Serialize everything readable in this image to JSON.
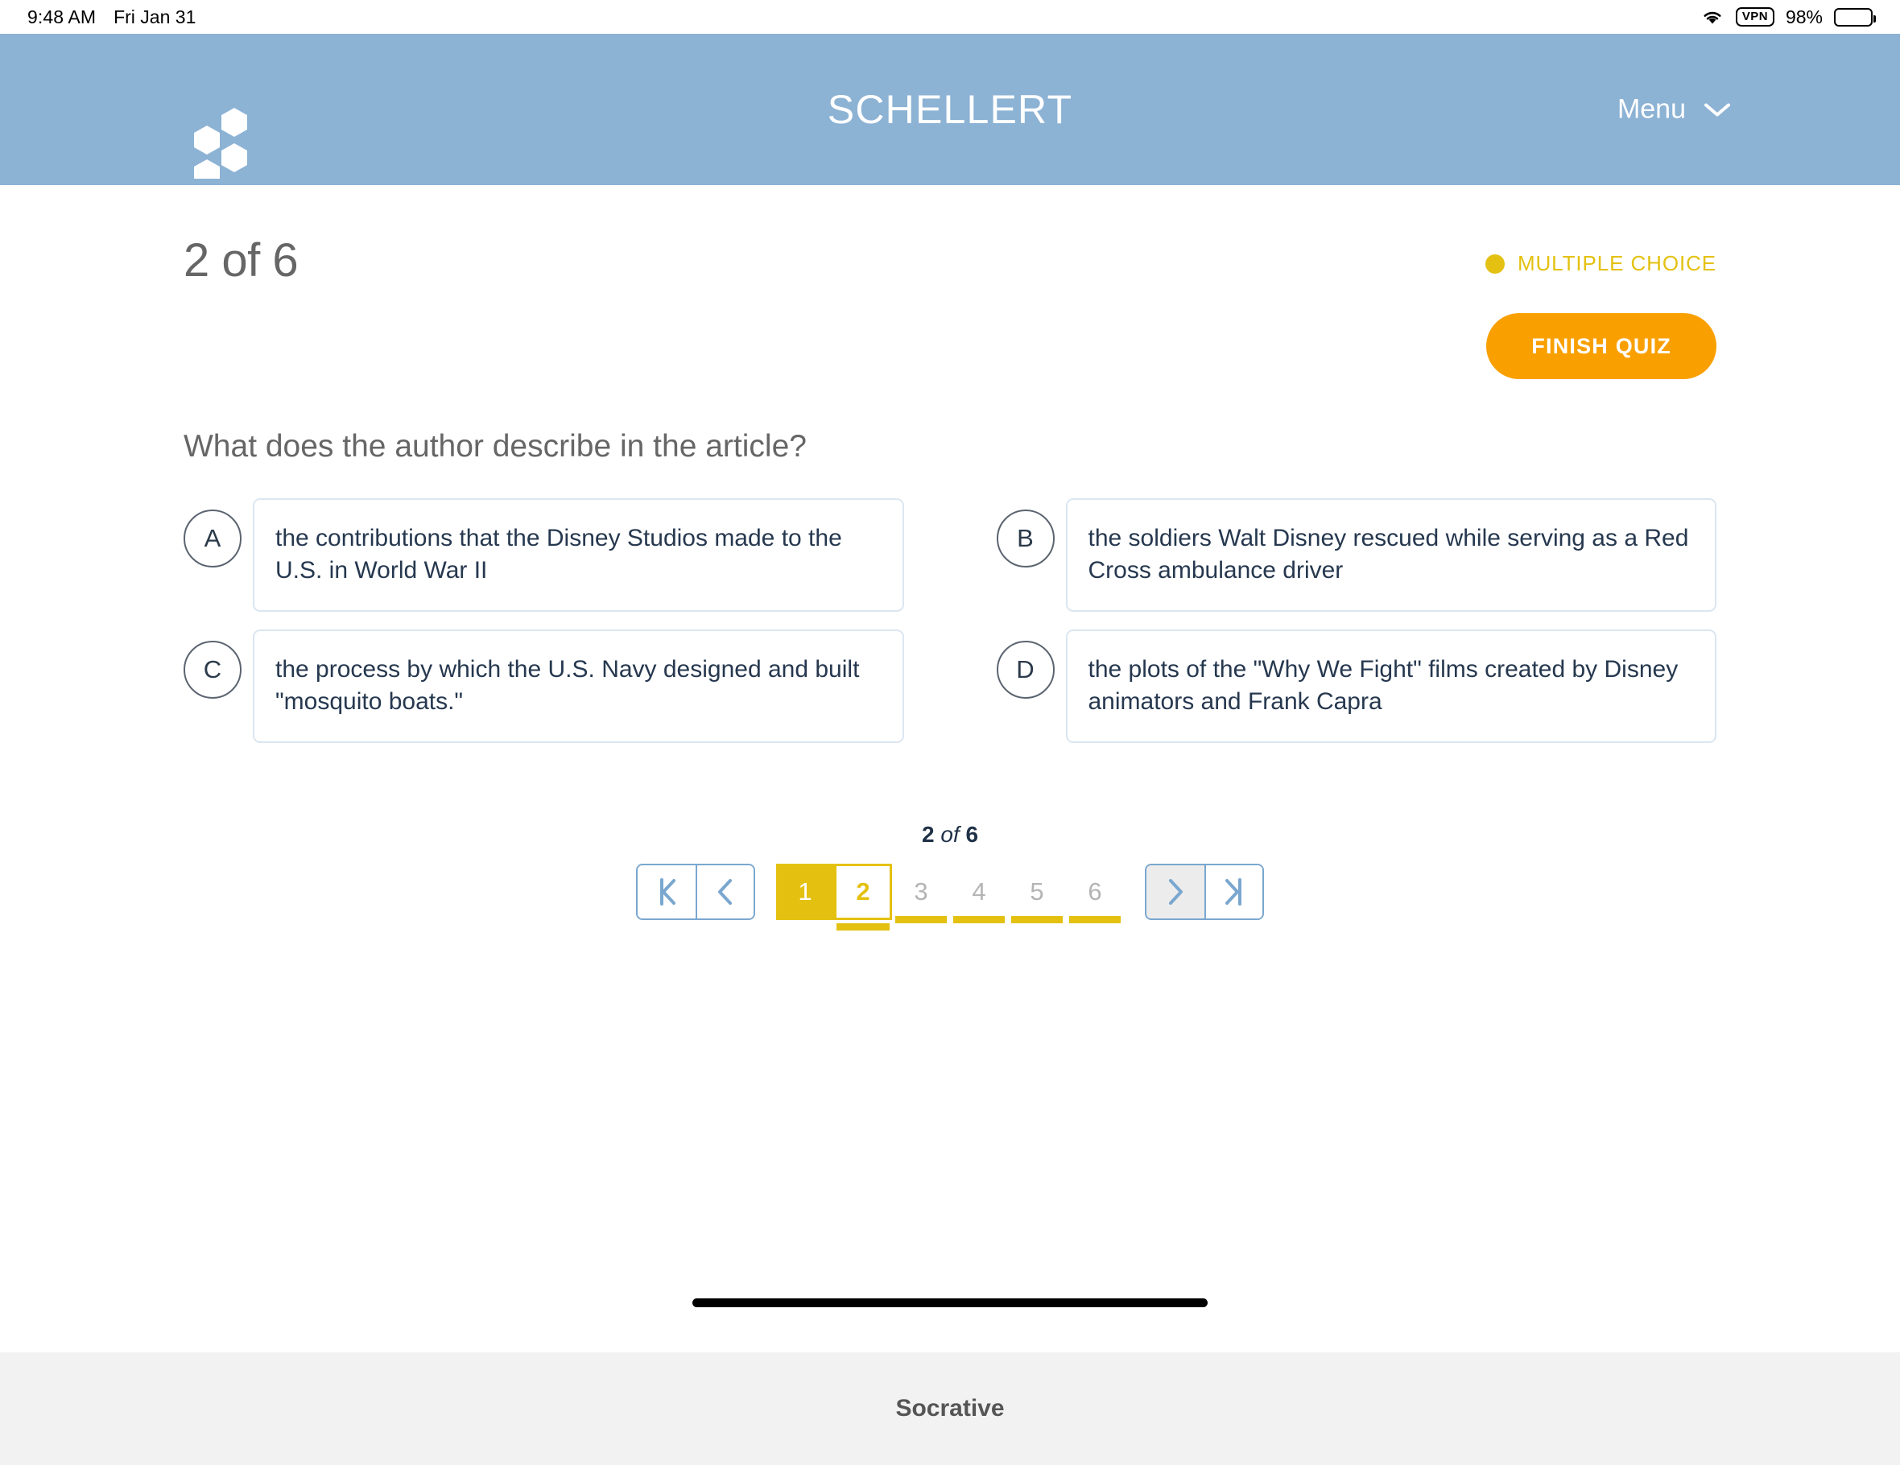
{
  "status_bar": {
    "time": "9:48 AM",
    "date": "Fri Jan 31",
    "wifi_icon": "wifi-icon",
    "vpn_label": "VPN",
    "battery_percent": "98%",
    "battery_icon": "battery-icon"
  },
  "header": {
    "logo_icon": "hexagon-cluster-logo",
    "title": "SCHELLERT",
    "menu_label": "Menu",
    "menu_chevron_icon": "chevron-down-icon",
    "background_color": "#8cb2d4"
  },
  "quiz": {
    "counter": "2 of 6",
    "type_badge": {
      "dot_icon": "status-dot",
      "label": "MULTIPLE CHOICE",
      "color": "#e4c111"
    },
    "finish_button": {
      "label": "FINISH QUIZ",
      "color": "#f9a000"
    },
    "question": "What does the author describe in the article?",
    "options": [
      {
        "letter": "A",
        "text": "the contributions that the Disney Studios made to the U.S. in World War II"
      },
      {
        "letter": "B",
        "text": "the soldiers Walt Disney rescued while serving as a Red Cross ambulance driver"
      },
      {
        "letter": "C",
        "text": "the process by which the U.S. Navy designed and built \"mosquito boats.\""
      },
      {
        "letter": "D",
        "text": "the plots of the \"Why We Fight\" films created by Disney animators and Frank Capra"
      }
    ]
  },
  "pagination": {
    "label_current": "2",
    "label_of": "of",
    "label_total": "6",
    "first_icon": "first-page-icon",
    "prev_icon": "previous-page-icon",
    "next_icon": "next-page-icon",
    "last_icon": "last-page-icon",
    "pages": [
      {
        "number": "1",
        "state": "answered"
      },
      {
        "number": "2",
        "state": "active"
      },
      {
        "number": "3",
        "state": "plain"
      },
      {
        "number": "4",
        "state": "plain"
      },
      {
        "number": "5",
        "state": "plain"
      },
      {
        "number": "6",
        "state": "plain"
      }
    ]
  },
  "footer": {
    "brand": "Socrative"
  }
}
